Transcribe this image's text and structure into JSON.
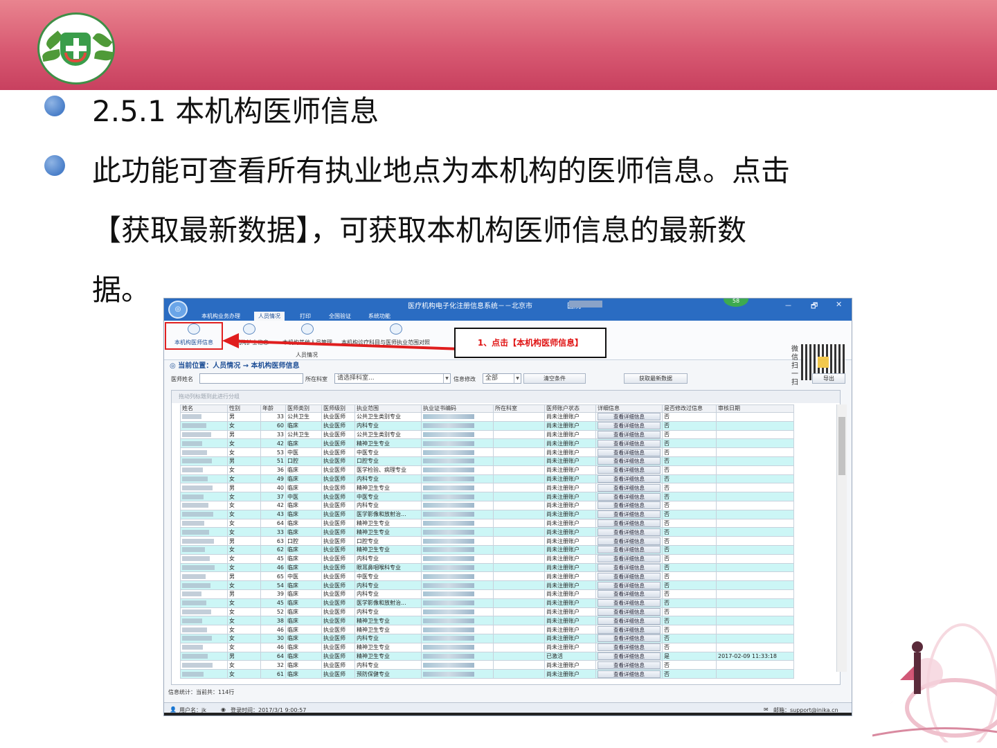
{
  "slide": {
    "heading": "2.5.1 本机构医师信息",
    "para_line1": "此功能可查看所有执业地点为本机构的医师信息。点击",
    "para_line2": "【获取最新数据】，可获取本机构医师信息的最新数",
    "para_line3": "据。"
  },
  "colors": {
    "header_band": "#d85a72",
    "callout_text": "#e01414",
    "row_alt": "#ccf6f6",
    "titlebar": "#2a6cc2"
  },
  "app": {
    "title": "医疗机构电子化注册信息系统－－北京市",
    "title_suffix": "医院",
    "badge": "58",
    "win_min": "－",
    "win_restore": "🗗",
    "win_close": "✕",
    "menu": [
      "本机构业务办理",
      "人员情况",
      "打印",
      "全国验证",
      "系统功能"
    ],
    "ribbon": [
      "本机构医师信息",
      "本机构护士信息",
      "本机构其他人员管理",
      "本机构诊疗科目与医师执业范围对照"
    ],
    "ribbon_group": "人员情况",
    "callout": "1、点击【本机构医师信息】",
    "qr_label": "微信扫一扫",
    "breadcrumb": "当前位置：人员情况 → 本机构医师信息",
    "filters": {
      "name_label": "医师姓名",
      "dept_label": "所在科室",
      "dept_placeholder": "请选择科室...",
      "status_label": "信息修改",
      "status_value": "全部",
      "clear_button": "清空条件",
      "fetch_button": "获取最新数据",
      "export_button": "导出"
    },
    "group_hint": "拖动列标题到此进行分组",
    "columns": [
      "姓名",
      "性别",
      "年龄",
      "医师类别",
      "医师级别",
      "执业范围",
      "执业证书编码",
      "所在科室",
      "医师账户状态",
      "详细信息",
      "是否修改过信息",
      "审核日期"
    ],
    "detail_label": "查看详细信息",
    "rows": [
      [
        "男",
        "33",
        "公共卫生",
        "执业医师",
        "公共卫生类别专业",
        "尚未注册账户",
        "否",
        ""
      ],
      [
        "女",
        "60",
        "临床",
        "执业医师",
        "内科专业",
        "尚未注册账户",
        "否",
        ""
      ],
      [
        "男",
        "33",
        "公共卫生",
        "执业医师",
        "公共卫生类别专业",
        "尚未注册账户",
        "否",
        ""
      ],
      [
        "女",
        "42",
        "临床",
        "执业医师",
        "精神卫生专业",
        "尚未注册账户",
        "否",
        ""
      ],
      [
        "女",
        "53",
        "中医",
        "执业医师",
        "中医专业",
        "尚未注册账户",
        "否",
        ""
      ],
      [
        "男",
        "51",
        "口腔",
        "执业医师",
        "口腔专业",
        "尚未注册账户",
        "否",
        ""
      ],
      [
        "女",
        "36",
        "临床",
        "执业医师",
        "医学检验、病理专业",
        "尚未注册账户",
        "否",
        ""
      ],
      [
        "女",
        "49",
        "临床",
        "执业医师",
        "内科专业",
        "尚未注册账户",
        "否",
        ""
      ],
      [
        "男",
        "40",
        "临床",
        "执业医师",
        "精神卫生专业",
        "尚未注册账户",
        "否",
        ""
      ],
      [
        "女",
        "37",
        "中医",
        "执业医师",
        "中医专业",
        "尚未注册账户",
        "否",
        ""
      ],
      [
        "女",
        "42",
        "临床",
        "执业医师",
        "内科专业",
        "尚未注册账户",
        "否",
        ""
      ],
      [
        "女",
        "43",
        "临床",
        "执业医师",
        "医学影像和放射治...",
        "尚未注册账户",
        "否",
        ""
      ],
      [
        "女",
        "64",
        "临床",
        "执业医师",
        "精神卫生专业",
        "尚未注册账户",
        "否",
        ""
      ],
      [
        "女",
        "33",
        "临床",
        "执业医师",
        "精神卫生专业",
        "尚未注册账户",
        "否",
        ""
      ],
      [
        "男",
        "63",
        "口腔",
        "执业医师",
        "口腔专业",
        "尚未注册账户",
        "否",
        ""
      ],
      [
        "女",
        "62",
        "临床",
        "执业医师",
        "精神卫生专业",
        "尚未注册账户",
        "否",
        ""
      ],
      [
        "女",
        "45",
        "临床",
        "执业医师",
        "内科专业",
        "尚未注册账户",
        "否",
        ""
      ],
      [
        "女",
        "46",
        "临床",
        "执业医师",
        "眼耳鼻咽喉科专业",
        "尚未注册账户",
        "否",
        ""
      ],
      [
        "男",
        "65",
        "中医",
        "执业医师",
        "中医专业",
        "尚未注册账户",
        "否",
        ""
      ],
      [
        "女",
        "54",
        "临床",
        "执业医师",
        "内科专业",
        "尚未注册账户",
        "否",
        ""
      ],
      [
        "男",
        "39",
        "临床",
        "执业医师",
        "内科专业",
        "尚未注册账户",
        "否",
        ""
      ],
      [
        "女",
        "45",
        "临床",
        "执业医师",
        "医学影像和放射治...",
        "尚未注册账户",
        "否",
        ""
      ],
      [
        "女",
        "52",
        "临床",
        "执业医师",
        "内科专业",
        "尚未注册账户",
        "否",
        ""
      ],
      [
        "女",
        "38",
        "临床",
        "执业医师",
        "精神卫生专业",
        "尚未注册账户",
        "否",
        ""
      ],
      [
        "女",
        "46",
        "临床",
        "执业医师",
        "精神卫生专业",
        "尚未注册账户",
        "否",
        ""
      ],
      [
        "女",
        "30",
        "临床",
        "执业医师",
        "内科专业",
        "尚未注册账户",
        "否",
        ""
      ],
      [
        "女",
        "46",
        "临床",
        "执业医师",
        "精神卫生专业",
        "尚未注册账户",
        "否",
        ""
      ],
      [
        "男",
        "64",
        "临床",
        "执业医师",
        "精神卫生专业",
        "已激活",
        "是",
        "2017-02-09 11:33:18"
      ],
      [
        "女",
        "32",
        "临床",
        "执业医师",
        "内科专业",
        "尚未注册账户",
        "否",
        ""
      ],
      [
        "女",
        "61",
        "临床",
        "执业医师",
        "预防保健专业",
        "尚未注册账户",
        "否",
        ""
      ]
    ],
    "stats": "信息统计：当前共：114行",
    "status_user": "用户名：jk",
    "status_login": "登录时间：2017/3/1 9:00:57",
    "status_mail": "邮箱：support@inika.cn"
  }
}
